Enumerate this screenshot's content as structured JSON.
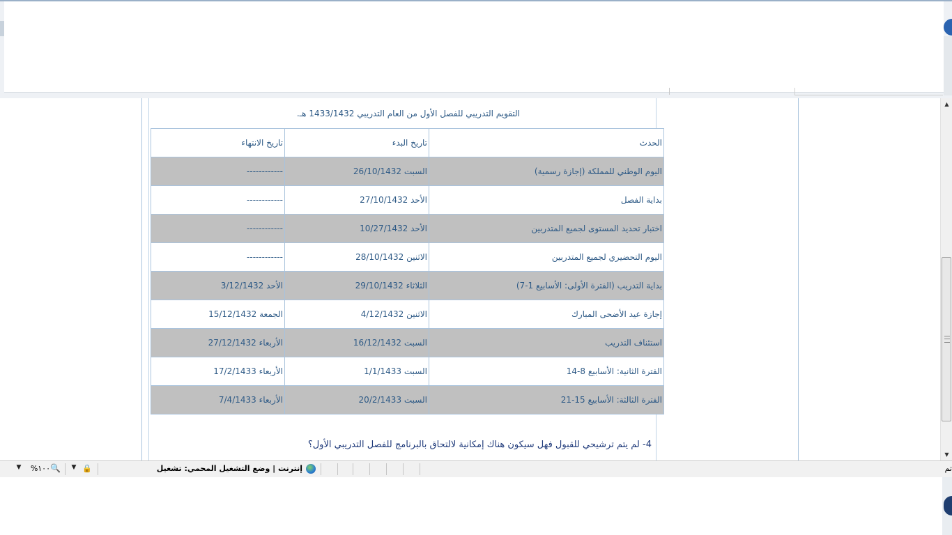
{
  "calendar": {
    "title": "التقويم التدريبي للفصل الأول من العام التدريبي 1433/1432 هـ.",
    "headers": {
      "event": "الحدث",
      "start": "تاريخ البدء",
      "end": "تاريخ الانتهاء"
    },
    "rows": [
      {
        "event": "اليوم الوطني للمملكة (إجازة رسمية)",
        "start": "السبت 26/10/1432",
        "end": "------------"
      },
      {
        "event": "بداية الفصل",
        "start": "الأحد 27/10/1432",
        "end": "------------"
      },
      {
        "event": "اختبار تحديد المستوى لجميع المتدربين",
        "start": "الأحد 10/27/1432",
        "end": "------------"
      },
      {
        "event": "اليوم التحضيري لجميع المتدربين",
        "start": "الاثنين 28/10/1432",
        "end": "------------"
      },
      {
        "event": "بداية التدريب (الفترة الأولى: الأسابيع 1-7)",
        "start": "الثلاثاء 29/10/1432",
        "end": "الأحد 3/12/1432"
      },
      {
        "event": "إجازة عيد الأضحى المبارك",
        "start": "الاثنين 4/12/1432",
        "end": "الجمعة 15/12/1432"
      },
      {
        "event": "استئناف التدريب",
        "start": "السبت 16/12/1432",
        "end": "الأربعاء 27/12/1432"
      },
      {
        "event": "الفترة الثانية: الأسابيع 8-14",
        "start": "السبت 1/1/1433",
        "end": "الأربعاء 17/2/1433"
      },
      {
        "event": "الفترة الثالثة: الأسابيع 15-21",
        "start": "السبت 20/2/1433",
        "end": "الأربعاء 7/4/1433"
      }
    ]
  },
  "question": "4- لم يتم ترشيحي للقبول فهل سيكون هناك إمكانية لالتحاق بالبرنامج للفصل التدريبي الأول؟",
  "statusbar": {
    "ready": "تم",
    "zone": "إنترنت | وضع التشغيل المحمي: تشغيل",
    "zoom": "١٠٠%",
    "zone_icon": "globe-icon",
    "security_icon": "lock-icon",
    "zoom_icon": "magnifier-icon"
  },
  "colors": {
    "row_shade": "#c0c0c0",
    "text": "#2e5a86",
    "border": "#a9c3dd",
    "question_text": "#1f3a7a"
  }
}
